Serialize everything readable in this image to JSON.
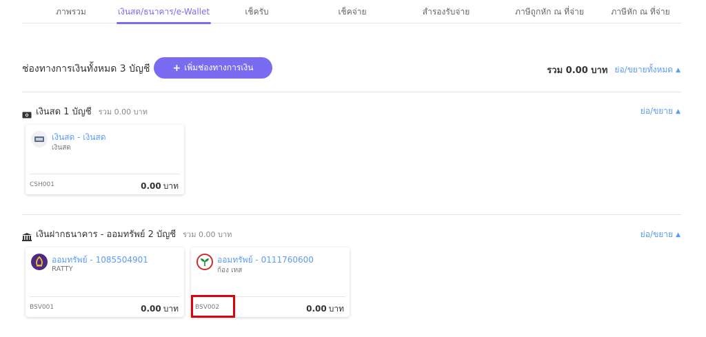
{
  "tabs": [
    {
      "label": "ภาพรวม",
      "active": false
    },
    {
      "label": "เงินสด/ธนาคาร/e-Wallet",
      "active": true
    },
    {
      "label": "เช็ครับ",
      "active": false
    },
    {
      "label": "เช็คจ่าย",
      "active": false
    },
    {
      "label": "สำรองรับจ่าย",
      "active": false
    },
    {
      "label": "ภาษีถูกหัก ณ ที่จ่าย",
      "active": false
    },
    {
      "label": "ภาษีหัก ณ ที่จ่าย",
      "active": false
    }
  ],
  "header": {
    "title": "ช่องทางการเงินทั้งหมด 3 บัญชี",
    "add_button": "เพิ่มช่องทางการเงิน",
    "add_button_icon": "+",
    "total": "รวม 0.00 บาท",
    "toggle_all": "ย่อ/ขยายทั้งหมด"
  },
  "cash": {
    "title": "เงินสด 1 บัญชี",
    "sum": "รวม 0.00 บาท",
    "toggle": "ย่อ/ขยาย",
    "cards": [
      {
        "name": "เงินสด - เงินสด",
        "sub": "เงินสด",
        "code": "CSH001",
        "amount": "0.00",
        "currency": "บาท"
      }
    ]
  },
  "bank": {
    "title": "เงินฝากธนาคาร - ออมทรัพย์ 2 บัญชี",
    "sum": "รวม 0.00 บาท",
    "toggle": "ย่อ/ขยาย",
    "cards": [
      {
        "name": "ออมทรัพย์ - 1085504901",
        "sub": "RATTY",
        "code": "BSV001",
        "amount": "0.00",
        "currency": "บาท"
      },
      {
        "name": "ออมทรัพย์ - 0111760600",
        "sub": "ก้อง เทส",
        "code": "BSV002",
        "amount": "0.00",
        "currency": "บาท"
      }
    ]
  },
  "colors": {
    "accent": "#7a6cf0",
    "link": "#5a9bf5",
    "highlight": "#e0000b"
  }
}
